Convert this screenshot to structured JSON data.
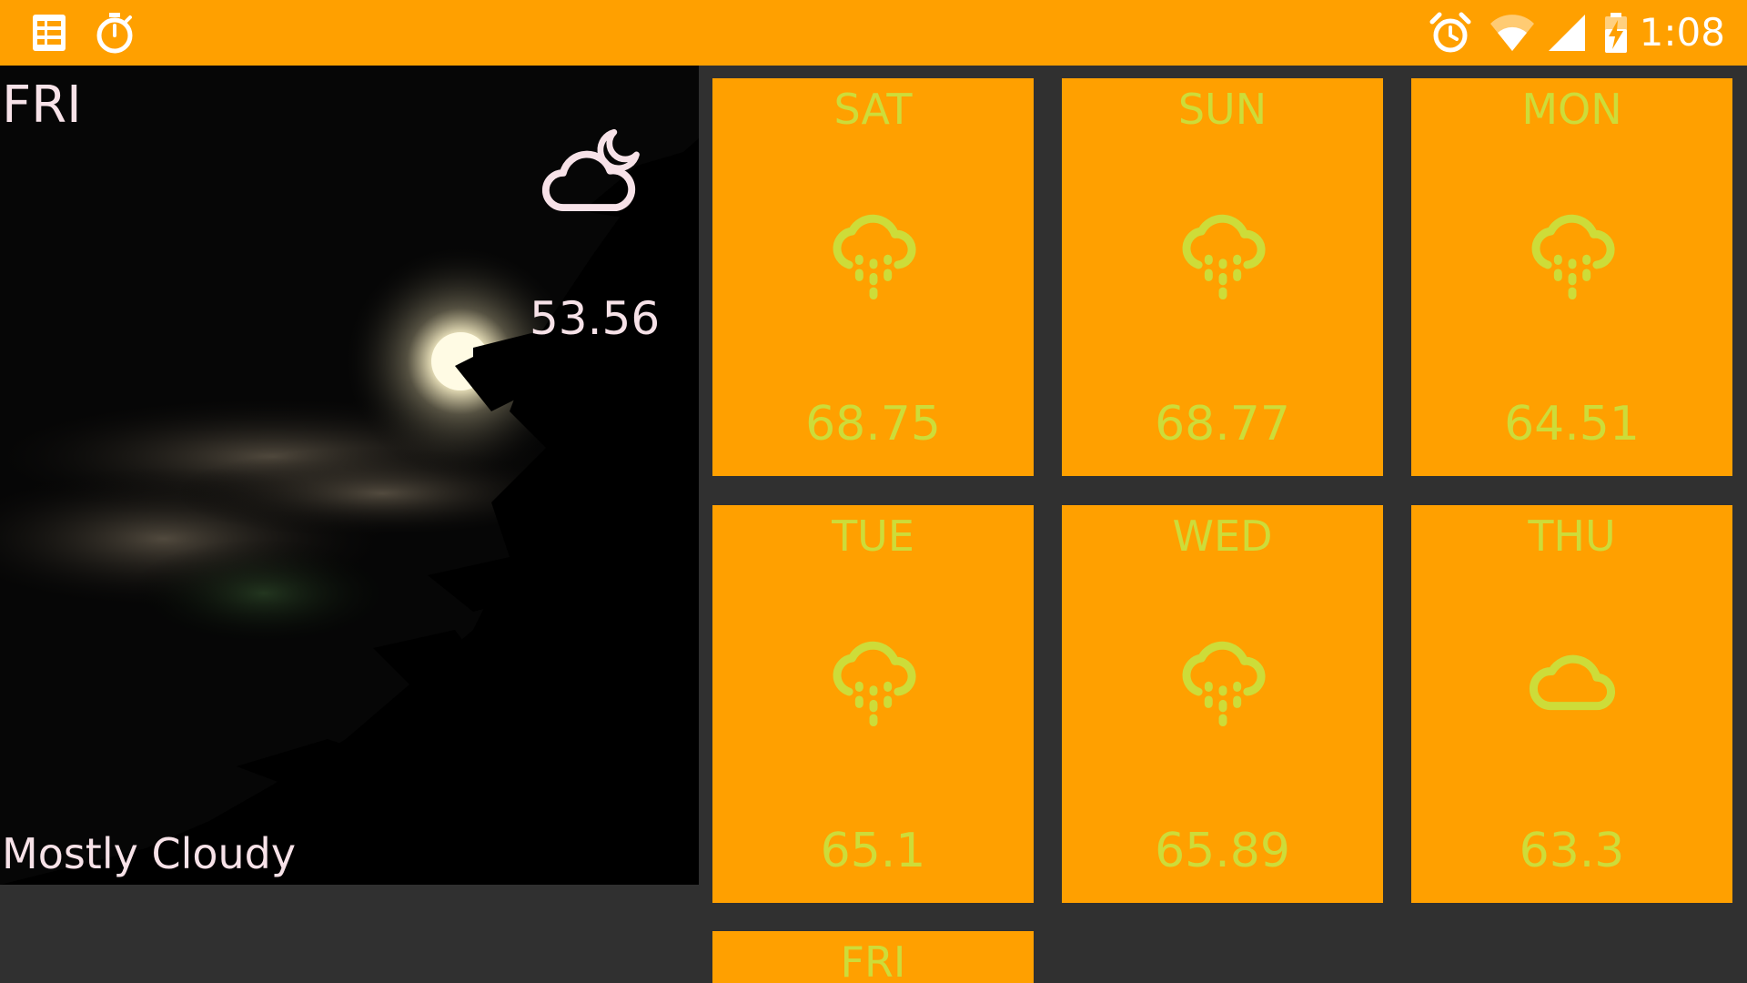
{
  "status_bar": {
    "time": "1:08",
    "left_icons": [
      "notes-icon",
      "stopwatch-icon"
    ],
    "right_icons": [
      "alarm-icon",
      "wifi-icon",
      "cell-signal-icon",
      "battery-charging-icon"
    ]
  },
  "today": {
    "day": "FRI",
    "temperature": "53.56",
    "condition": "Mostly Cloudy",
    "icon": "partly-cloudy-night-icon"
  },
  "forecast": [
    {
      "day": "SAT",
      "temperature": "68.75",
      "icon": "rain-icon"
    },
    {
      "day": "SUN",
      "temperature": "68.77",
      "icon": "rain-icon"
    },
    {
      "day": "MON",
      "temperature": "64.51",
      "icon": "rain-icon"
    },
    {
      "day": "TUE",
      "temperature": "65.1",
      "icon": "rain-icon"
    },
    {
      "day": "WED",
      "temperature": "65.89",
      "icon": "rain-icon"
    },
    {
      "day": "THU",
      "temperature": "63.3",
      "icon": "cloud-icon"
    },
    {
      "day": "FRI",
      "temperature": "",
      "icon": ""
    }
  ],
  "colors": {
    "accent": "#FFA000",
    "tile_text": "#CDDC39",
    "background": "#303030",
    "hero_text": "#F7E2E8"
  }
}
